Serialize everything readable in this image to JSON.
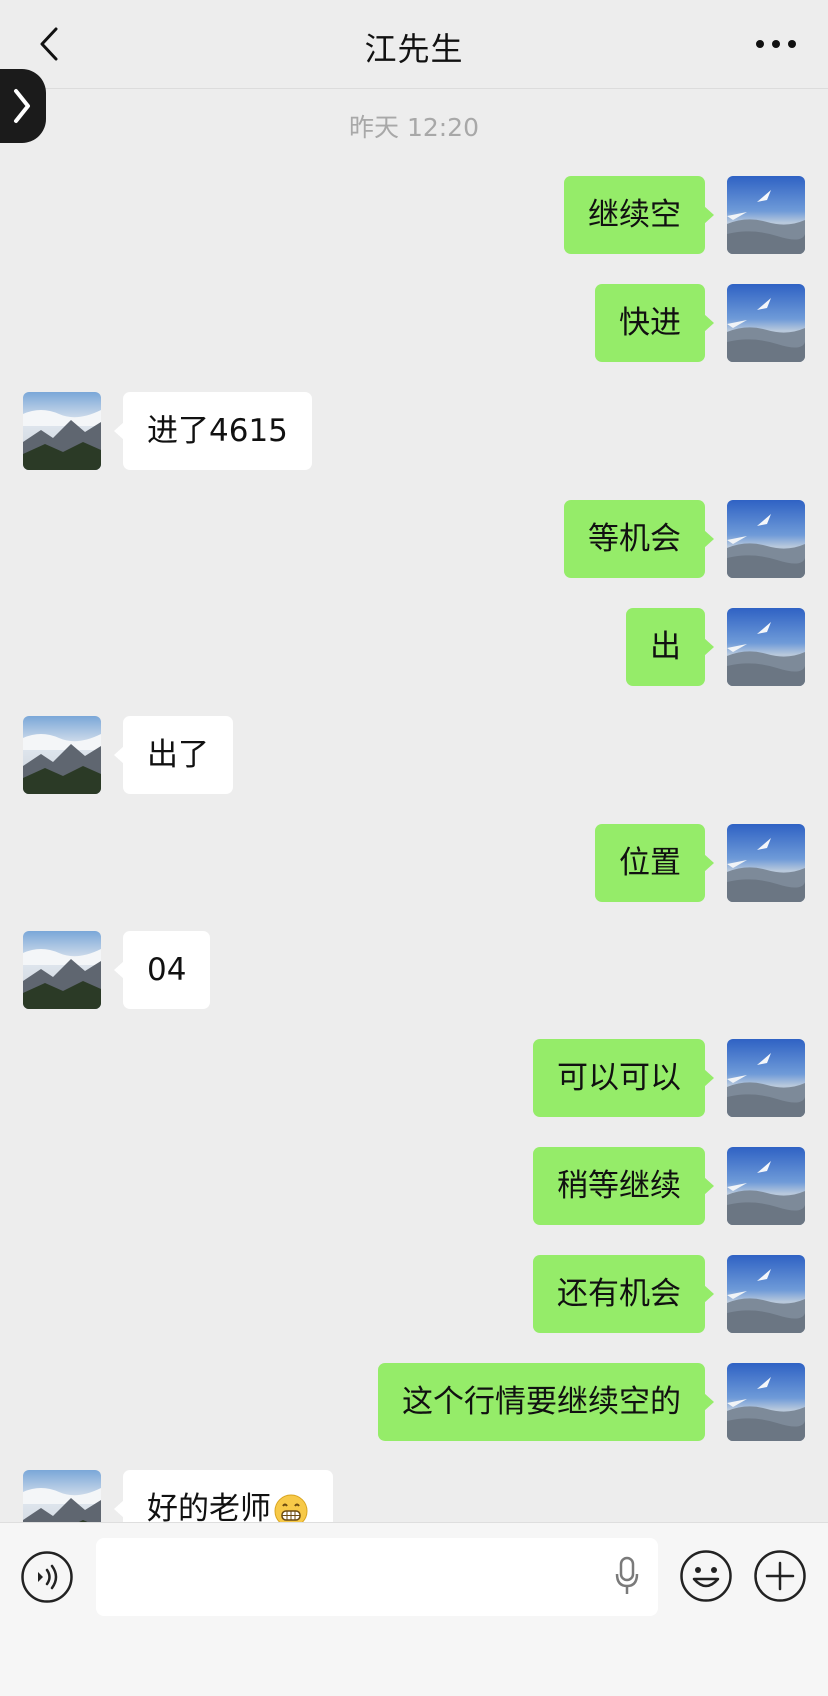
{
  "header": {
    "title": "江先生"
  },
  "timestamp": "昨天 12:20",
  "messages": [
    {
      "from": "me",
      "text": "继续空"
    },
    {
      "from": "me",
      "text": "快进"
    },
    {
      "from": "other",
      "text": "进了4615"
    },
    {
      "from": "me",
      "text": "等机会"
    },
    {
      "from": "me",
      "text": "出"
    },
    {
      "from": "other",
      "text": "出了"
    },
    {
      "from": "me",
      "text": "位置"
    },
    {
      "from": "other",
      "text": "04"
    },
    {
      "from": "me",
      "text": "可以可以"
    },
    {
      "from": "me",
      "text": "稍等继续"
    },
    {
      "from": "me",
      "text": "还有机会"
    },
    {
      "from": "me",
      "text": "这个行情要继续空的"
    },
    {
      "from": "other",
      "text": "好的老师",
      "emoji": "grinning-face-emoji"
    }
  ],
  "icons": {
    "back": "chevron-left-icon",
    "more": "more-dots-icon",
    "voice": "voice-icon",
    "mic": "microphone-icon",
    "emoji": "smiley-icon",
    "plus": "plus-icon"
  },
  "colors": {
    "my_bubble": "#95ec69",
    "other_bubble": "#ffffff",
    "background": "#ededed"
  }
}
